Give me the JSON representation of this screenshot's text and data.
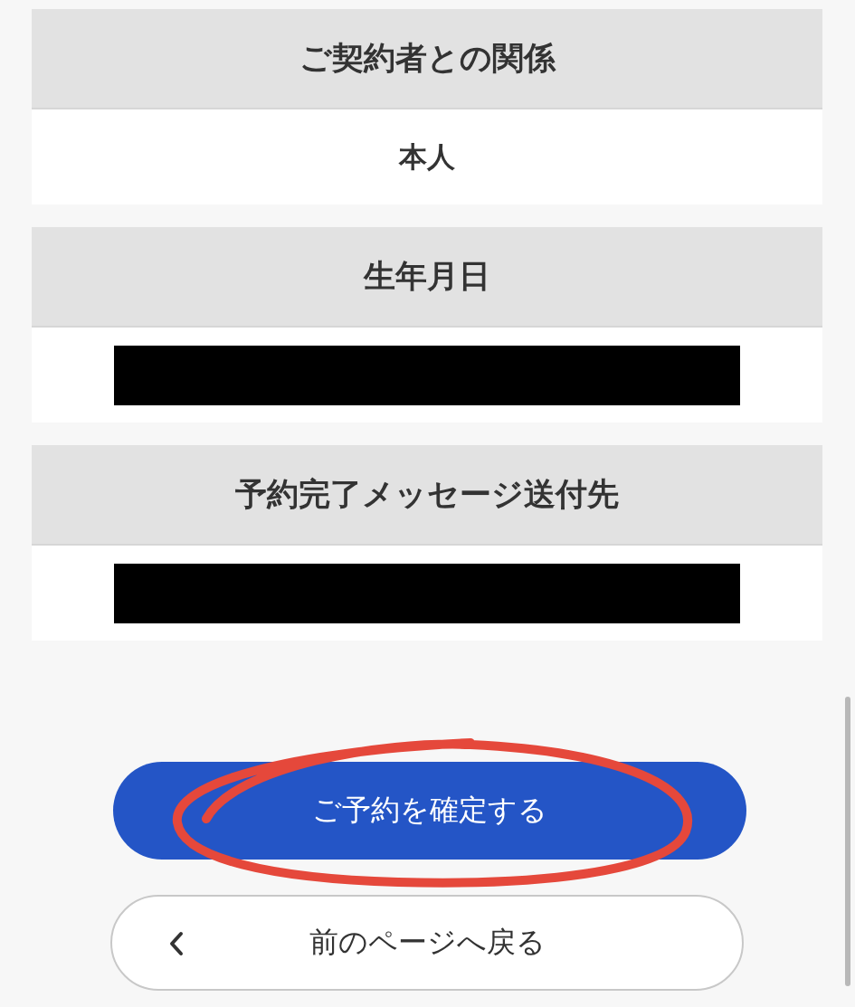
{
  "sections": [
    {
      "label": "ご契約者との関係",
      "value": "本人",
      "redacted": false
    },
    {
      "label": "生年月日",
      "redacted": true
    },
    {
      "label": "予約完了メッセージ送付先",
      "redacted": true
    }
  ],
  "confirm_button": {
    "label": "ご予約を確定する",
    "circled": true
  },
  "back_button": {
    "label": "前のページへ戻る"
  }
}
